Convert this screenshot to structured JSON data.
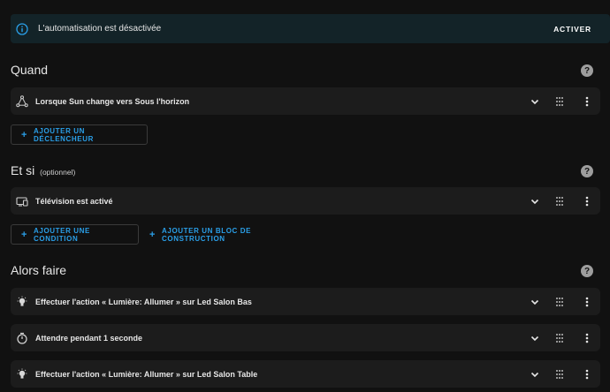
{
  "banner": {
    "message": "L'automatisation est désactivée",
    "action_label": "ACTIVER"
  },
  "sections": {
    "when": {
      "title": "Quand",
      "triggers": [
        {
          "label": "Lorsque Sun change vers Sous l'horizon",
          "icon": "triangle-nodes-icon"
        }
      ],
      "add_trigger_label": "AJOUTER UN DÉCLENCHEUR"
    },
    "and_if": {
      "title": "Et si",
      "subtitle": "(optionnel)",
      "conditions": [
        {
          "label": "Télévision est activé",
          "icon": "devices-icon"
        }
      ],
      "add_condition_label": "AJOUTER UNE CONDITION",
      "add_block_label": "AJOUTER UN BLOC DE CONSTRUCTION"
    },
    "then_do": {
      "title": "Alors faire",
      "actions": [
        {
          "label": "Effectuer l'action « Lumière: Allumer » sur Led Salon Bas",
          "icon": "lightbulb-icon"
        },
        {
          "label": "Attendre pendant 1 seconde",
          "icon": "timer-icon"
        },
        {
          "label": "Effectuer l'action « Lumière: Allumer » sur Led Salon Table",
          "icon": "lightbulb-icon"
        }
      ]
    }
  },
  "icons": {
    "help": "?",
    "plus": "+"
  },
  "colors": {
    "background": "#111111",
    "card": "#1c1c1c",
    "banner_bg": "#132328",
    "accent": "#2a9fe8"
  }
}
